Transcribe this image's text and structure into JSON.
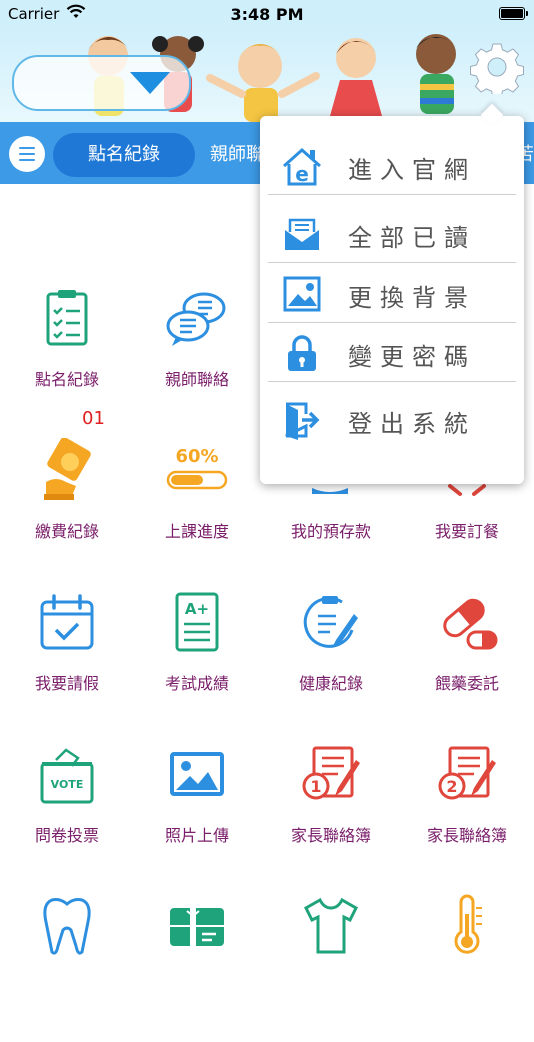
{
  "status_bar": {
    "carrier": "Carrier",
    "time": "3:48 PM"
  },
  "tabs": {
    "active": "點名紀錄",
    "next": "親師聯",
    "partial": "苦"
  },
  "grid": {
    "badge": "01",
    "items": [
      {
        "label": "點名紀錄",
        "icon": "clipboard-checklist-icon"
      },
      {
        "label": "親師聯絡",
        "icon": "chat-bubbles-icon"
      },
      {
        "label": "",
        "icon": "hidden-icon"
      },
      {
        "label": "",
        "icon": "hidden-icon"
      },
      {
        "label": "繳費紀錄",
        "icon": "payment-coin-icon"
      },
      {
        "label": "上課進度",
        "icon": "progress-bar-icon"
      },
      {
        "label": "我的預存款",
        "icon": "savings-icon"
      },
      {
        "label": "我要訂餐",
        "icon": "meal-order-icon"
      },
      {
        "label": "我要請假",
        "icon": "calendar-check-icon"
      },
      {
        "label": "考試成績",
        "icon": "grade-report-icon"
      },
      {
        "label": "健康紀錄",
        "icon": "health-record-icon"
      },
      {
        "label": "餵藥委託",
        "icon": "pill-icon"
      },
      {
        "label": "問卷投票",
        "icon": "vote-box-icon"
      },
      {
        "label": "照片上傳",
        "icon": "photo-upload-icon"
      },
      {
        "label": "家長聯絡簿",
        "icon": "contact-book-1-icon"
      },
      {
        "label": "家長聯絡簿",
        "icon": "contact-book-2-icon"
      },
      {
        "label": "",
        "icon": "tooth-icon"
      },
      {
        "label": "",
        "icon": "gift-card-icon"
      },
      {
        "label": "",
        "icon": "shirt-icon"
      },
      {
        "label": "",
        "icon": "thermometer-icon"
      }
    ]
  },
  "popup_menu": {
    "items": [
      {
        "label": "進入官網",
        "icon": "website-home-icon"
      },
      {
        "label": "全部已讀",
        "icon": "mail-read-icon"
      },
      {
        "label": "更換背景",
        "icon": "image-background-icon"
      },
      {
        "label": "變更密碼",
        "icon": "lock-icon"
      },
      {
        "label": "登出系統",
        "icon": "logout-door-icon"
      }
    ]
  },
  "colors": {
    "accent": "#3d9ae6",
    "active_tab": "#1f78d6",
    "label": "#7a1e6a",
    "badge": "#e02020",
    "icon_green": "#1fa37a",
    "icon_blue": "#2d8fe0",
    "icon_red": "#e0463c"
  }
}
